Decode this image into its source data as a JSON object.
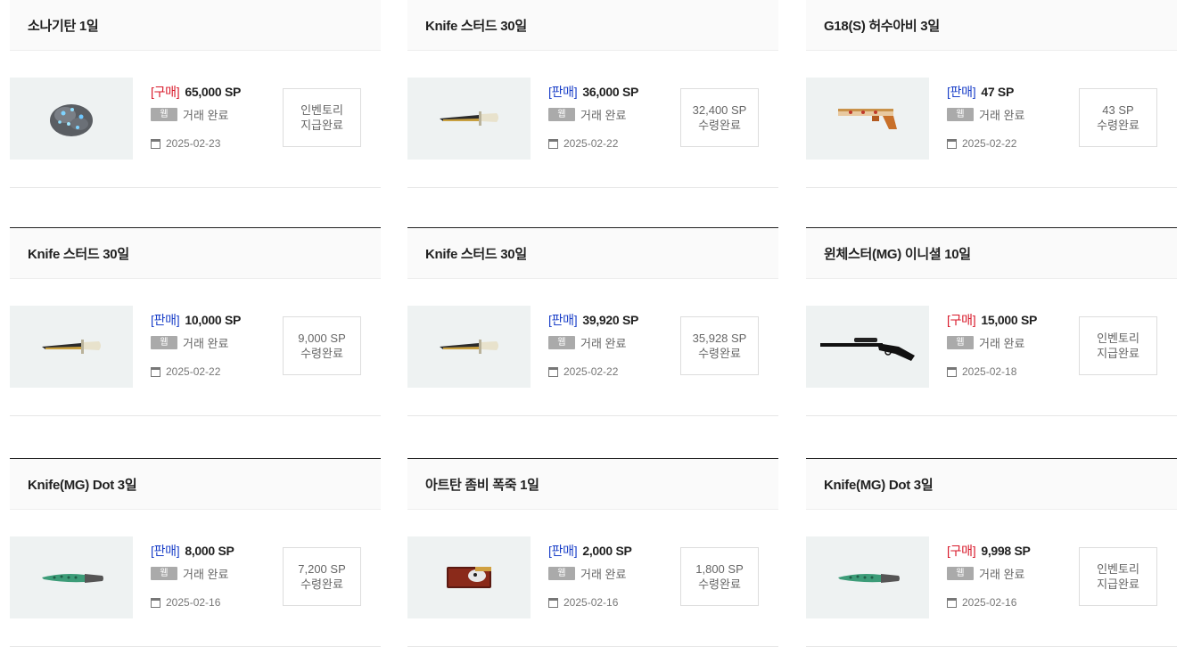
{
  "items": [
    {
      "title": "소나기탄 1일",
      "tag": "[구매]",
      "tag_type": "buy",
      "price": "65,000 SP",
      "badge": "웹",
      "trade_status": "거래 완료",
      "date": "2025-02-23",
      "status_line1": "인벤토리",
      "status_line2": "지급완료",
      "icon": "ore-icon"
    },
    {
      "title": "Knife 스터드 30일",
      "tag": "[판매]",
      "tag_type": "sell",
      "price": "36,000 SP",
      "badge": "웹",
      "trade_status": "거래 완료",
      "date": "2025-02-22",
      "status_line1": "32,400 SP",
      "status_line2": "수령완료",
      "icon": "knife-icon"
    },
    {
      "title": "G18(S) 허수아비 3일",
      "tag": "[판매]",
      "tag_type": "sell",
      "price": "47 SP",
      "badge": "웹",
      "trade_status": "거래 완료",
      "date": "2025-02-22",
      "status_line1": "43 SP",
      "status_line2": "수령완료",
      "icon": "pistol-icon"
    },
    {
      "title": "Knife 스터드 30일",
      "tag": "[판매]",
      "tag_type": "sell",
      "price": "10,000 SP",
      "badge": "웹",
      "trade_status": "거래 완료",
      "date": "2025-02-22",
      "status_line1": "9,000 SP",
      "status_line2": "수령완료",
      "icon": "knife-icon"
    },
    {
      "title": "Knife 스터드 30일",
      "tag": "[판매]",
      "tag_type": "sell",
      "price": "39,920 SP",
      "badge": "웹",
      "trade_status": "거래 완료",
      "date": "2025-02-22",
      "status_line1": "35,928 SP",
      "status_line2": "수령완료",
      "icon": "knife-icon"
    },
    {
      "title": "윈체스터(MG) 이니셜 10일",
      "tag": "[구매]",
      "tag_type": "buy",
      "price": "15,000 SP",
      "badge": "웹",
      "trade_status": "거래 완료",
      "date": "2025-02-18",
      "status_line1": "인벤토리",
      "status_line2": "지급완료",
      "icon": "rifle-icon"
    },
    {
      "title": "Knife(MG) Dot 3일",
      "tag": "[판매]",
      "tag_type": "sell",
      "price": "8,000 SP",
      "badge": "웹",
      "trade_status": "거래 완료",
      "date": "2025-02-16",
      "status_line1": "7,200 SP",
      "status_line2": "수령완료",
      "icon": "green-knife-icon"
    },
    {
      "title": "아트탄 좀비 폭죽 1일",
      "tag": "[판매]",
      "tag_type": "sell",
      "price": "2,000 SP",
      "badge": "웹",
      "trade_status": "거래 완료",
      "date": "2025-02-16",
      "status_line1": "1,800 SP",
      "status_line2": "수령완료",
      "icon": "firework-box-icon"
    },
    {
      "title": "Knife(MG) Dot 3일",
      "tag": "[구매]",
      "tag_type": "buy",
      "price": "9,998 SP",
      "badge": "웹",
      "trade_status": "거래 완료",
      "date": "2025-02-16",
      "status_line1": "인벤토리",
      "status_line2": "지급완료",
      "icon": "green-knife-icon"
    }
  ],
  "colors": {
    "buy": "#d8192a",
    "sell": "#1a3fc8",
    "badge": "#aaaaaa",
    "thumb_bg": "#eef2f2"
  }
}
